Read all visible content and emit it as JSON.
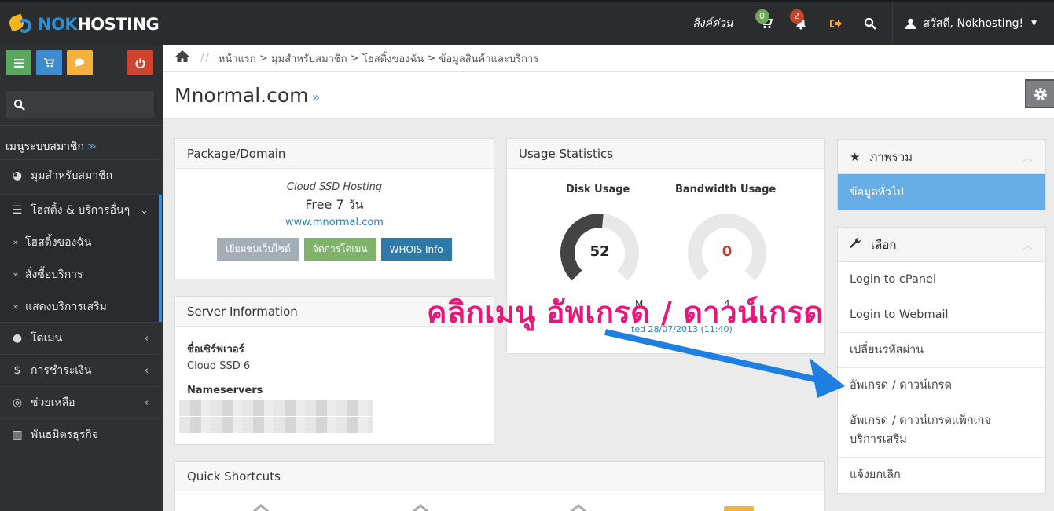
{
  "brand": {
    "logo_nok": "NOK",
    "logo_hosting": "HOSTING",
    "brand_blue": "#2d8cd6",
    "brand_yellow": "#f7b51c"
  },
  "topbar": {
    "quick_link": "ลิงค์ด่วน",
    "cart_icon": "shopping-cart-icon",
    "cart_count": "0",
    "bell_icon": "bell-icon",
    "notifications_count": "2",
    "signout_icon": "sign-out-icon",
    "search_icon": "search-icon",
    "greeting": "สวัสดี, Nokhosting!"
  },
  "sidebar": {
    "search_placeholder": "",
    "menu_title": "เมนูระบบสมาชิก",
    "items": [
      {
        "label": "มุมสำหรับสมาชิก",
        "icon": "dashboard-icon"
      },
      {
        "label": "โฮสติ้ง & บริการอื่นๆ",
        "icon": "list-icon"
      },
      {
        "label": "โฮสติ้งของฉัน",
        "icon": "double-chevron-icon"
      },
      {
        "label": "สั่งซื้อบริการ",
        "icon": "double-chevron-icon"
      },
      {
        "label": "แสดงบริการเสริม",
        "icon": "double-chevron-icon"
      },
      {
        "label": "โดเมน",
        "icon": "globe-icon"
      },
      {
        "label": "การชำระเงิน",
        "icon": "dollar-icon"
      },
      {
        "label": "ช่วยเหลือ",
        "icon": "lifebuoy-icon"
      },
      {
        "label": "พันธมิตรธุรกิจ",
        "icon": "bar-chart-icon"
      }
    ]
  },
  "breadcrumb": {
    "sep": "//",
    "items": [
      "หน้าแรก",
      "มุมสำหรับสมาชิก",
      "โฮสติ้งของฉัน",
      "ข้อมูลสินค้าและบริการ"
    ],
    "join": ">"
  },
  "page": {
    "title": "Mnormal.com",
    "title_suffix": "»"
  },
  "package_panel": {
    "heading": "Package/Domain",
    "group": "Cloud SSD Hosting",
    "name": "Free 7 วัน",
    "domain": "www.mnormal.com",
    "buttons": [
      "เยี่ยมชมเว็บไซต์",
      "จัดการโดเมน",
      "WHOIS Info"
    ]
  },
  "server_panel": {
    "heading": "Server Information",
    "name_label": "ชื่อเซิร์ฟเวอร์",
    "name_value": "Cloud SSD 6",
    "ns_label": "Nameservers"
  },
  "usage_panel": {
    "heading": "Usage Statistics",
    "disk_label": "Disk Usage",
    "disk_value": "52",
    "disk_percent": 52,
    "bandwidth_label": "Bandwidth Usage",
    "bandwidth_value": "0",
    "bandwidth_percent": 0,
    "disk_text_fragment": "M",
    "bandwidth_text_fragment": "4",
    "updated_prefix": "l",
    "updated_text": "ted 28/07/2013 (11:40)"
  },
  "shortcuts_panel": {
    "heading": "Quick Shortcuts"
  },
  "overview_panel": {
    "heading": "ภาพรวม",
    "active_item": "ข้อมูลทั่วไป"
  },
  "actions_panel": {
    "heading": "เลือก",
    "links": [
      "Login to cPanel",
      "Login to Webmail",
      "เปลี่ยนรหัสผ่าน",
      "อัพเกรด / ดาวน์เกรด",
      "อัพเกรด / ดาวน์เกรดแพ็กเกจ บริการเสริม",
      "แจ้งยกเลิก"
    ]
  },
  "annotation": {
    "text": "คลิกเมนู อัพเกรด / ดาวน์เกรด",
    "color": "#e8157a",
    "arrow_color": "#1f7fe0"
  }
}
